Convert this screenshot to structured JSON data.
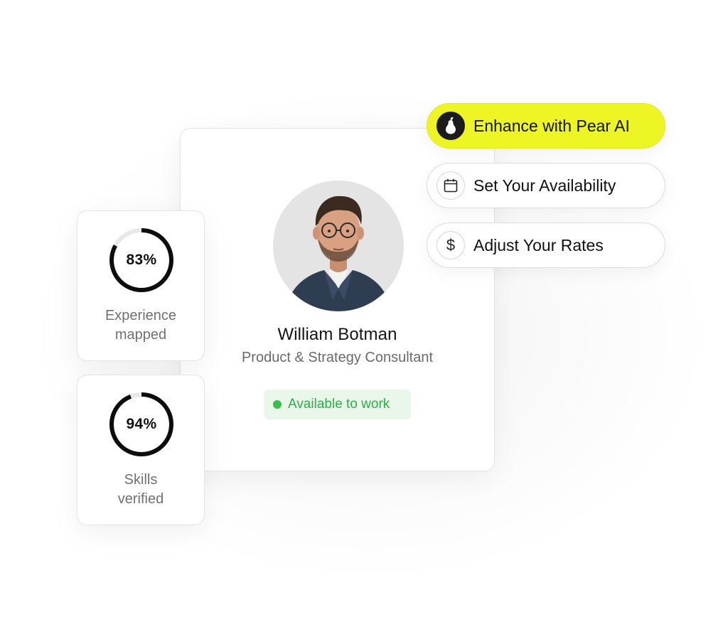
{
  "profile": {
    "name": "William Botman",
    "role": "Product & Strategy Consultant",
    "status": "Available to work",
    "status_color": "#35c04a"
  },
  "stats": [
    {
      "percent": 83,
      "value_label": "83%",
      "label_line1": "Experience",
      "label_line2": "mapped"
    },
    {
      "percent": 94,
      "value_label": "94%",
      "label_line1": "Skills",
      "label_line2": "verified"
    }
  ],
  "actions": {
    "enhance": {
      "label": "Enhance with Pear AI",
      "icon": "pear-icon",
      "color": "#eef524"
    },
    "availability": {
      "label": "Set Your Availability",
      "icon": "calendar-icon"
    },
    "rates": {
      "label": "Adjust Your Rates",
      "icon": "dollar-icon",
      "icon_text": "$"
    }
  }
}
